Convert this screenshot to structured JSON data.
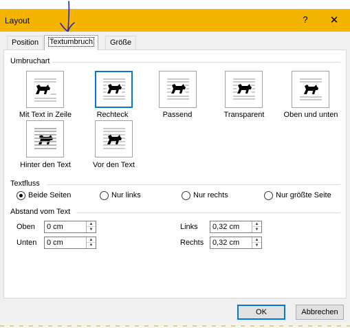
{
  "window": {
    "title": "Layout",
    "help": "?",
    "close": "✕"
  },
  "tabs": [
    {
      "label": "Position"
    },
    {
      "label": "Textumbruch"
    },
    {
      "label": "Größe"
    }
  ],
  "wrap": {
    "label": "Umbruchart",
    "options": [
      {
        "label": "Mit Text in Zeile",
        "icon": "inline-with-text-icon"
      },
      {
        "label": "Rechteck",
        "icon": "square-wrap-icon",
        "selected": true
      },
      {
        "label": "Passend",
        "icon": "tight-wrap-icon"
      },
      {
        "label": "Transparent",
        "icon": "through-wrap-icon"
      },
      {
        "label": "Oben und unten",
        "icon": "top-bottom-wrap-icon"
      },
      {
        "label": "Hinter den Text",
        "icon": "behind-text-icon"
      },
      {
        "label": "Vor den Text",
        "icon": "in-front-of-text-icon"
      }
    ]
  },
  "flow": {
    "label": "Textfluss",
    "options": [
      {
        "label": "Beide Seiten",
        "checked": true
      },
      {
        "label": "Nur links",
        "checked": false
      },
      {
        "label": "Nur rechts",
        "checked": false
      },
      {
        "label": "Nur größte Seite",
        "checked": false
      }
    ]
  },
  "distance": {
    "label": "Abstand vom Text",
    "top": {
      "label": "Oben",
      "value": "0 cm"
    },
    "bottom": {
      "label": "Unten",
      "value": "0 cm"
    },
    "left": {
      "label": "Links",
      "value": "0,32 cm"
    },
    "right": {
      "label": "Rechts",
      "value": "0,32 cm"
    }
  },
  "buttons": {
    "ok": "OK",
    "cancel": "Abbrechen"
  },
  "colors": {
    "titlebar": "#f5b400",
    "accent": "#0078d7",
    "annotation": "#2222cc"
  }
}
